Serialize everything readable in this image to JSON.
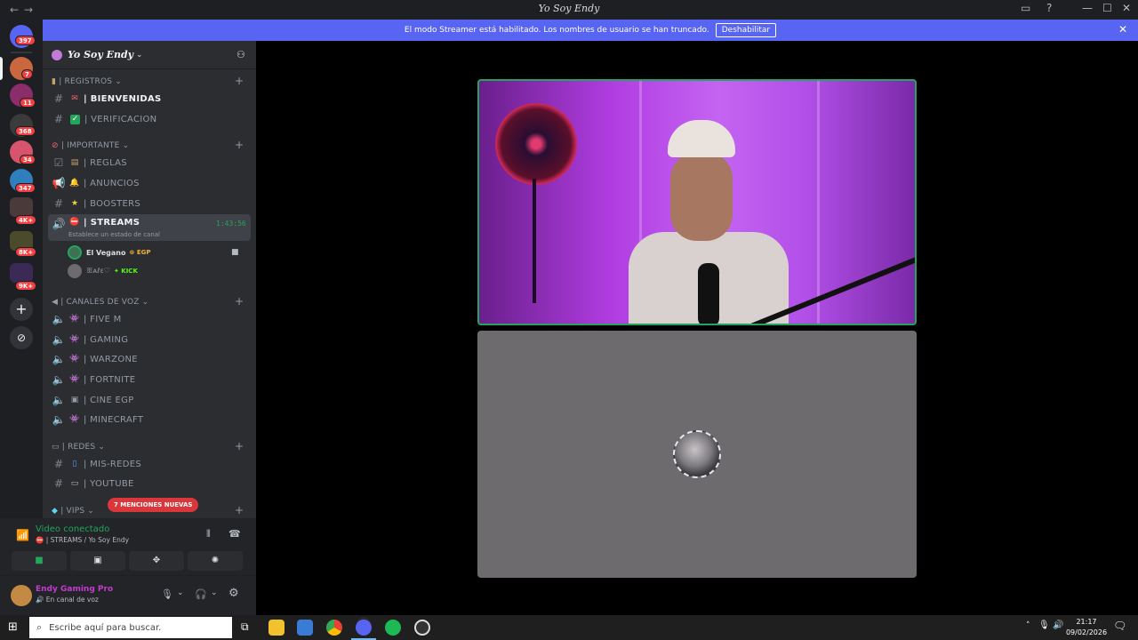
{
  "window": {
    "title": "Yo Soy Endy"
  },
  "banner": {
    "text": "El modo Streamer está habilitado. Los nombres de usuario se han truncado.",
    "button": "Deshabilitar"
  },
  "guilds": [
    {
      "badge": "397"
    },
    {
      "badge": "7"
    },
    {
      "badge": "11"
    },
    {
      "badge": "368"
    },
    {
      "badge": "34"
    },
    {
      "badge": "347"
    },
    {
      "badge": "4K+"
    },
    {
      "badge": "8K+"
    },
    {
      "badge": "9K+"
    }
  ],
  "server": {
    "name": "Yo Soy Endy"
  },
  "categories": {
    "registros": "| REGISTROS",
    "importante": "| IMPORTANTE",
    "voz": "| CANALES DE VOZ",
    "redes": "| REDES",
    "vips": "| VIPS"
  },
  "channels": {
    "bienvenidas": "| BIENVENIDAS",
    "verificacion": "| VERIFICACION",
    "reglas": "| REGLAS",
    "anuncios": "| ANUNCIOS",
    "boosters": "| BOOSTERS",
    "streams": "| STREAMS",
    "streams_timer": "1:43:56",
    "streams_status": "Establece un estado de canal",
    "fivem": "| FIVE M",
    "gaming": "|  GAMING",
    "warzone": "| WARZONE",
    "fortnite": "| FORTNITE",
    "cine": "| CINE EGP",
    "minecraft": "| MINECRAFT",
    "misredes": "| MIS-REDES",
    "youtube": "| YOUTUBE"
  },
  "voice_users": [
    {
      "name": "El Vegano",
      "tag": "EGP"
    },
    {
      "name": "ꕥᴀℓε♡",
      "tag": "KICK"
    }
  ],
  "mentions": "7 MENCIONES NUEVAS",
  "voice_panel": {
    "status": "Video conectado",
    "channel": "| STREAMS / Yo Soy Endy"
  },
  "user": {
    "name": "Endy Gaming Pro",
    "status": "En canal de voz"
  },
  "taskbar": {
    "search_placeholder": "Escribe aquí para buscar.",
    "time": "21:17",
    "date": "09/02/2026"
  },
  "colors": {
    "accent": "#5865f2",
    "online": "#23a55a",
    "danger": "#da373c"
  }
}
